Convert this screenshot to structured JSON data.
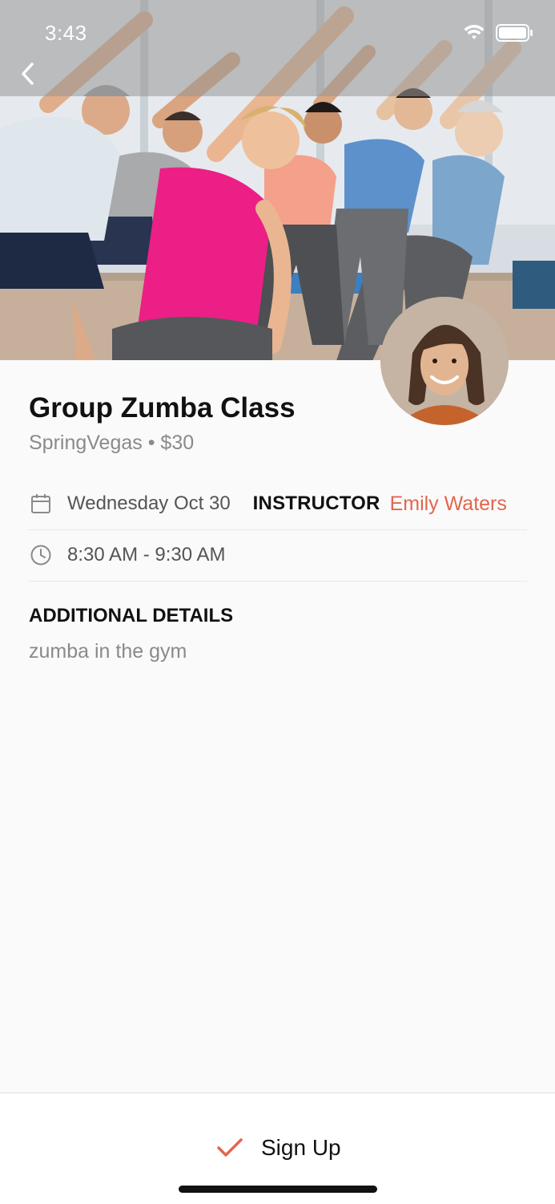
{
  "status_bar": {
    "time": "3:43"
  },
  "nav": {
    "back_icon": "chevron-left-icon"
  },
  "event": {
    "title": "Group Zumba Class",
    "subtitle": "SpringVegas • $30",
    "date": "Wednesday Oct 30",
    "instructor_label": "INSTRUCTOR",
    "instructor_name": "Emily Waters",
    "time_range": "8:30 AM - 9:30 AM"
  },
  "details": {
    "heading": "ADDITIONAL DETAILS",
    "text": "zumba in the gym"
  },
  "footer": {
    "signup_label": "Sign Up"
  },
  "colors": {
    "accent": "#e2664f",
    "text": "#111111",
    "muted": "#8a8a8a"
  }
}
